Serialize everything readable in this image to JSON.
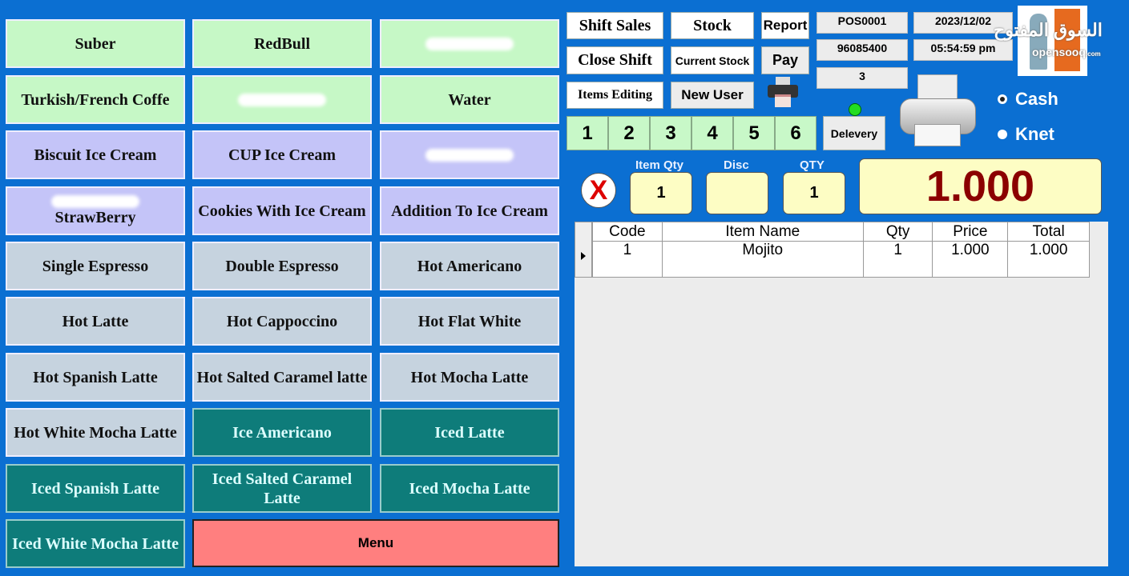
{
  "colors": {
    "background": "#0b6fd2",
    "green": "#c6f8c6",
    "lavender": "#c4c4f8",
    "slate": "#c6d3df",
    "teal": "#0e7c7a",
    "menu": "#ff7f7f",
    "total": "#8b0000"
  },
  "items": [
    {
      "label": "Suber",
      "color": "green"
    },
    {
      "label": "RedBull",
      "color": "green"
    },
    {
      "label": "",
      "color": "green",
      "redacted": true
    },
    {
      "label": "Turkish/French Coffe",
      "color": "green"
    },
    {
      "label": "",
      "color": "green",
      "redacted": true
    },
    {
      "label": "Water",
      "color": "green"
    },
    {
      "label": "Biscuit Ice Cream",
      "color": "lavender"
    },
    {
      "label": "CUP Ice Cream",
      "color": "lavender"
    },
    {
      "label": "",
      "color": "lavender",
      "redacted": true
    },
    {
      "label": "StrawBerry",
      "color": "lavender",
      "redacted": true
    },
    {
      "label": "Cookies With Ice Cream",
      "color": "lavender"
    },
    {
      "label": "Addition To Ice Cream",
      "color": "lavender"
    },
    {
      "label": "Single Espresso",
      "color": "slate"
    },
    {
      "label": "Double Espresso",
      "color": "slate"
    },
    {
      "label": "Hot Americano",
      "color": "slate"
    },
    {
      "label": "Hot Latte",
      "color": "slate"
    },
    {
      "label": "Hot Cappoccino",
      "color": "slate"
    },
    {
      "label": "Hot Flat White",
      "color": "slate"
    },
    {
      "label": "Hot Spanish Latte",
      "color": "slate"
    },
    {
      "label": "Hot Salted Caramel latte",
      "color": "slate"
    },
    {
      "label": "Hot Mocha Latte",
      "color": "slate"
    },
    {
      "label": "Hot White Mocha Latte",
      "color": "slate"
    },
    {
      "label": "Ice Americano",
      "color": "teal"
    },
    {
      "label": "Iced Latte",
      "color": "teal"
    },
    {
      "label": "Iced Spanish Latte",
      "color": "teal"
    },
    {
      "label": "Iced Salted Caramel Latte",
      "color": "teal"
    },
    {
      "label": "Iced Mocha Latte",
      "color": "teal"
    },
    {
      "label": "Iced White Mocha Latte",
      "color": "teal"
    }
  ],
  "menu_label": "Menu",
  "toolbar": {
    "shift_sales": "Shift Sales",
    "stock": "Stock",
    "report": "Report",
    "close_shift": "Close Shift",
    "current_stock": "Current Stock",
    "pay": "Pay",
    "items_editing": "Items Editing",
    "new_user": "New User",
    "delivery": "Delevery"
  },
  "info": {
    "pos": "POS0001",
    "date": "2023/12/02",
    "phone": "96085400",
    "time": "05:54:59 pm",
    "count": "3"
  },
  "tables": [
    "1",
    "2",
    "3",
    "4",
    "5",
    "6"
  ],
  "payment": {
    "cash": "Cash",
    "knet": "Knet",
    "selected": "Cash"
  },
  "entry": {
    "item_qty_label": "Item Qty",
    "item_qty": "1",
    "disc_label": "Disc",
    "disc": "",
    "qty_label": "QTY",
    "qty": "1",
    "total": "1.000"
  },
  "grid": {
    "headers": [
      "Code",
      "Item Name",
      "Qty",
      "Price",
      "Total"
    ],
    "rows": [
      [
        "1",
        "Mojito",
        "1",
        "1.000",
        "1.000"
      ]
    ]
  },
  "logo": {
    "arabic": "السوق المفتوح",
    "latin": "opensooq",
    "suffix": ".com"
  }
}
